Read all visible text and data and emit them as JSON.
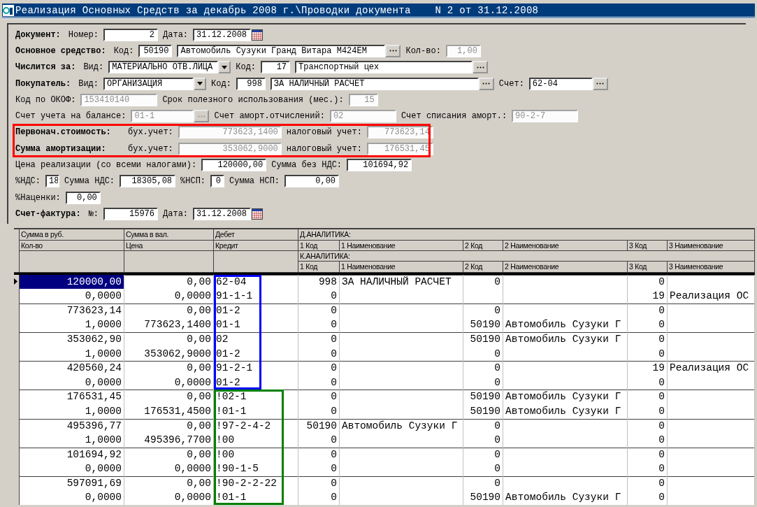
{
  "window": {
    "title": "Реализация Основных Средств за декабрь 2008 г.\\Проводки документа    N 2 от 31.12.2008"
  },
  "form": {
    "groups": [
      {
        "rows": [
          {
            "items": [
              {
                "kind": "heading",
                "text": "Документ:"
              },
              {
                "kind": "label",
                "text": "Номер:"
              },
              {
                "kind": "number",
                "value": "2",
                "disabled": false,
                "lookup": false
              },
              {
                "kind": "label",
                "text": "Дата:"
              },
              {
                "kind": "date",
                "value": "31.12.2008",
                "disabled": false
              }
            ]
          },
          {
            "items": [
              {
                "kind": "heading",
                "text": "Основное средство:"
              },
              {
                "kind": "label",
                "text": "Код:"
              },
              {
                "kind": "number",
                "value": "50190",
                "disabled": false,
                "lookup": false
              },
              {
                "kind": "text",
                "value": "Автомобиль Сузуки Гранд Витара М424ЕМ",
                "disabled": false,
                "lookup": true
              },
              {
                "kind": "label",
                "text": "Кол-во:"
              },
              {
                "kind": "number",
                "value": "1,00",
                "disabled": true,
                "lookup": false
              }
            ]
          },
          {
            "items": [
              {
                "kind": "heading",
                "text": "Числится за:"
              },
              {
                "kind": "label",
                "text": "Вид:"
              },
              {
                "kind": "combo",
                "value": "МАТЕРИАЛЬНО ОТВ.ЛИЦА",
                "disabled": false
              },
              {
                "kind": "label",
                "text": "Код:"
              },
              {
                "kind": "number",
                "value": "17",
                "disabled": false,
                "lookup": false
              },
              {
                "kind": "text",
                "value": "Транспортный цех",
                "disabled": false,
                "lookup": true
              }
            ]
          },
          {
            "items": [
              {
                "kind": "heading",
                "text": "Покупатель:"
              },
              {
                "kind": "label",
                "text": "Вид:"
              },
              {
                "kind": "combo",
                "value": "ОРГАНИЗАЦИЯ",
                "disabled": false
              },
              {
                "kind": "label",
                "text": "Код:"
              },
              {
                "kind": "number",
                "value": "998",
                "disabled": false,
                "lookup": false
              },
              {
                "kind": "text",
                "value": "ЗА НАЛИЧНЫЙ РАСЧЕТ",
                "disabled": false,
                "lookup": true
              },
              {
                "kind": "label",
                "text": "Счет:"
              },
              {
                "kind": "text",
                "value": "62-04",
                "disabled": false,
                "lookup": true
              }
            ]
          },
          {
            "items": [
              {
                "kind": "label",
                "text": "Код по ОКОФ:"
              },
              {
                "kind": "text",
                "value": "153410140",
                "disabled": true,
                "lookup": false
              },
              {
                "kind": "label",
                "text": "Срок полезного использования (мес.):"
              },
              {
                "kind": "number",
                "value": "15",
                "disabled": true,
                "lookup": false
              }
            ]
          },
          {
            "items": [
              {
                "kind": "label",
                "text": "Счет учета на балансе:"
              },
              {
                "kind": "text",
                "value": "01-1",
                "disabled": true,
                "lookup": true
              },
              {
                "kind": "label",
                "text": "Счет аморт.отчислений:"
              },
              {
                "kind": "text",
                "value": "02",
                "disabled": true,
                "lookup": false
              },
              {
                "kind": "label",
                "text": "Счет списания аморт.:"
              },
              {
                "kind": "text",
                "value": "90-2-7",
                "disabled": true,
                "lookup": false
              }
            ]
          }
        ]
      },
      {
        "color": "#ff0000",
        "rows": [
          {
            "items": [
              {
                "kind": "heading",
                "text": "Первонач.стоимость:"
              },
              {
                "kind": "label",
                "text": "бух.учет:"
              },
              {
                "kind": "number",
                "value": "773623,1400",
                "disabled": true,
                "lookup": false
              },
              {
                "kind": "label",
                "text": "налоговый учет:"
              },
              {
                "kind": "number",
                "value": "773623,14",
                "disabled": true,
                "lookup": false
              }
            ]
          },
          {
            "items": [
              {
                "kind": "heading",
                "text": "Сумма амортизации:"
              },
              {
                "kind": "label",
                "text": "бух.учет:"
              },
              {
                "kind": "number",
                "value": "353062,9000",
                "disabled": true,
                "lookup": false
              },
              {
                "kind": "label",
                "text": "налоговый учет:"
              },
              {
                "kind": "number",
                "value": "176531,45",
                "disabled": true,
                "lookup": false
              }
            ]
          }
        ]
      },
      {
        "rows": [
          {
            "items": [
              {
                "kind": "label",
                "text": "Цена реализации (со всеми налогами):"
              },
              {
                "kind": "number",
                "value": "120000,00",
                "disabled": false,
                "lookup": false
              },
              {
                "kind": "label",
                "text": "Сумма без НДС:"
              },
              {
                "kind": "number",
                "value": "101694,92",
                "disabled": false,
                "lookup": false
              }
            ]
          },
          {
            "items": [
              {
                "kind": "label",
                "text": "%НДС:"
              },
              {
                "kind": "number",
                "value": "18",
                "disabled": false,
                "lookup": false
              },
              {
                "kind": "label",
                "text": "Сумма НДС:"
              },
              {
                "kind": "number",
                "value": "18305,08",
                "disabled": false,
                "lookup": false
              },
              {
                "kind": "label",
                "text": "%НСП:"
              },
              {
                "kind": "number",
                "value": "0",
                "disabled": false,
                "lookup": false
              },
              {
                "kind": "label",
                "text": "Сумма НСП:"
              },
              {
                "kind": "number",
                "value": "0,00",
                "disabled": false,
                "lookup": false
              }
            ]
          },
          {
            "items": [
              {
                "kind": "label",
                "text": "%Наценки:"
              },
              {
                "kind": "number",
                "value": "0,00",
                "disabled": false,
                "lookup": false
              }
            ]
          },
          {
            "items": [
              {
                "kind": "heading",
                "text": "Счет-фактура:"
              },
              {
                "kind": "label",
                "text": "№:"
              },
              {
                "kind": "number",
                "value": "15976",
                "disabled": false,
                "lookup": false
              },
              {
                "kind": "label",
                "text": "Дата:"
              },
              {
                "kind": "date",
                "value": "31.12.2008",
                "disabled": false
              }
            ]
          }
        ]
      }
    ]
  },
  "grid": {
    "header": {
      "top": [
        "Сумма в руб.",
        "Сумма в вал.",
        "Дебет"
      ],
      "second": [
        "Кол-во",
        "Цена",
        "Кредит"
      ],
      "debit_title": "Д.АНАЛИТИКА:",
      "debit_columns": [
        "1 Код",
        "1 Наименование",
        "2 Код",
        "2 Наименование",
        "3 Код",
        "3 Наименование"
      ],
      "credit_title": "К.АНАЛИТИКА:",
      "credit_columns": [
        "1 Код",
        "1 Наименование",
        "2 Код",
        "2 Наименование",
        "3 Код",
        "3 Наименование"
      ]
    },
    "groups": [
      {
        "color": "#0000ff",
        "rows": [
          {
            "selected": true,
            "cells": [
              "120000,00",
              "0,00",
              "62-04",
              "998",
              "ЗА НАЛИЧНЫЙ РАСЧЕТ",
              "0",
              null,
              "0",
              null
            ]
          },
          {
            "selected": false,
            "cells": [
              "0,0000",
              "0,0000",
              "91-1-1",
              "0",
              null,
              null,
              null,
              "19",
              "Реализация ОС"
            ]
          },
          {
            "selected": false,
            "cells": [
              "773623,14",
              "0,00",
              "01-2",
              "0",
              null,
              "0",
              null,
              "0",
              null
            ]
          },
          {
            "selected": false,
            "cells": [
              "1,0000",
              "773623,1400",
              "01-1",
              "0",
              null,
              "50190",
              "Автомобиль Сузуки Г",
              "0",
              null
            ]
          },
          {
            "selected": false,
            "cells": [
              "353062,90",
              "0,00",
              "02",
              "0",
              null,
              "50190",
              "Автомобиль Сузуки Г",
              "0",
              null
            ]
          },
          {
            "selected": false,
            "cells": [
              "1,0000",
              "353062,9000",
              "01-2",
              "0",
              null,
              "0",
              null,
              "0",
              null
            ]
          },
          {
            "selected": false,
            "cells": [
              "420560,24",
              "0,00",
              "91-2-1",
              "0",
              null,
              "0",
              null,
              "19",
              "Реализация ОС"
            ]
          },
          {
            "selected": false,
            "cells": [
              "0,0000",
              "0,0000",
              "01-2",
              "0",
              null,
              "0",
              null,
              "0",
              null
            ]
          }
        ]
      },
      {
        "color": "#008000",
        "rows": [
          {
            "selected": false,
            "cells": [
              "176531,45",
              "0,00",
              "!02-1",
              "0",
              null,
              "50190",
              "Автомобиль Сузуки Г",
              "0",
              null
            ]
          },
          {
            "selected": false,
            "cells": [
              "1,0000",
              "176531,4500",
              "!01-1",
              "0",
              null,
              "50190",
              "Автомобиль Сузуки Г",
              "0",
              null
            ]
          },
          {
            "selected": false,
            "cells": [
              "495396,77",
              "0,00",
              "!97-2-4-2",
              "50190",
              "Автомобиль Сузуки Г",
              "0",
              null,
              "0",
              null
            ]
          },
          {
            "selected": false,
            "cells": [
              "1,0000",
              "495396,7700",
              "!00",
              "0",
              null,
              "0",
              null,
              "0",
              null
            ]
          },
          {
            "selected": false,
            "cells": [
              "101694,92",
              "0,00",
              "!00",
              "0",
              null,
              "0",
              null,
              "0",
              null
            ]
          },
          {
            "selected": false,
            "cells": [
              "0,0000",
              "0,0000",
              "!90-1-5",
              "0",
              null,
              "0",
              null,
              "0",
              null
            ]
          },
          {
            "selected": false,
            "cells": [
              "597091,69",
              "0,00",
              "!90-2-2-22",
              "0",
              null,
              "0",
              null,
              "0",
              null
            ]
          },
          {
            "selected": false,
            "cells": [
              "0,0000",
              "0,0000",
              "!01-1",
              "0",
              null,
              "50190",
              "Автомобиль Сузуки Г",
              "0",
              null
            ]
          }
        ]
      }
    ]
  }
}
